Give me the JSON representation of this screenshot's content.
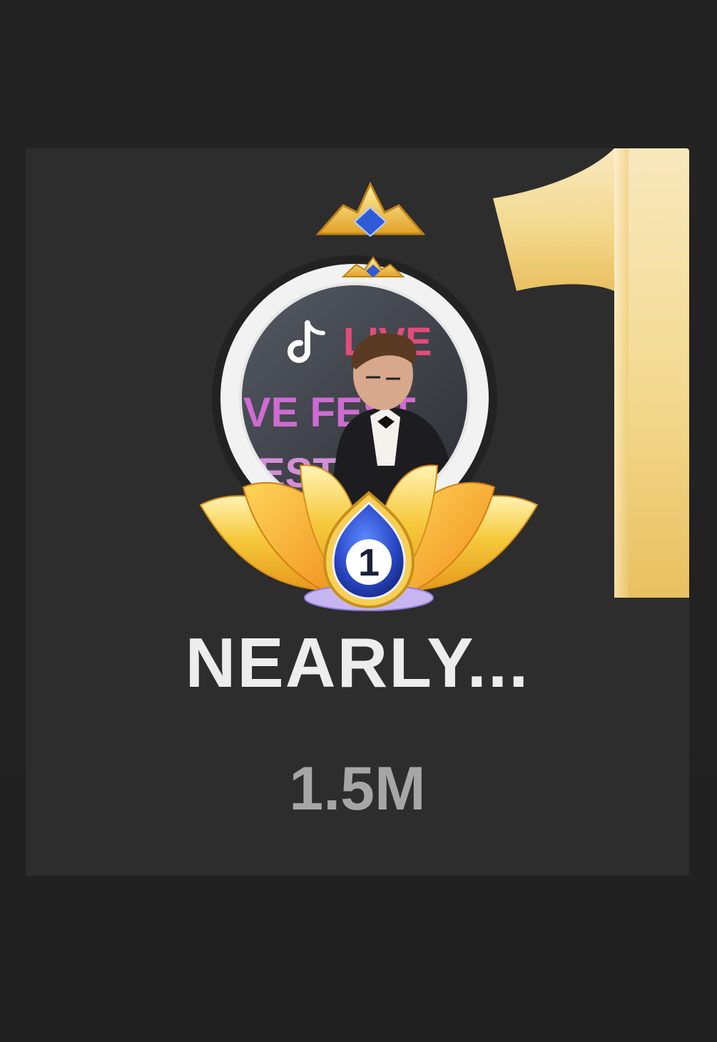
{
  "leaderboard_entry": {
    "rank": "1",
    "badge_rank": "1",
    "username": "NEARLY...",
    "score": "1.5M",
    "avatar_caption_1": "LIVE",
    "avatar_caption_2": "VE FEST",
    "avatar_caption_3": "EST",
    "rank_color": "#f1cf7f",
    "accent_blue": "#2f5bd6",
    "icons": {
      "crown": "crown-icon",
      "lotus": "lotus-frame-icon",
      "rank_badge": "rank-badge-icon",
      "app_logo": "tiktok-logo-icon"
    }
  }
}
